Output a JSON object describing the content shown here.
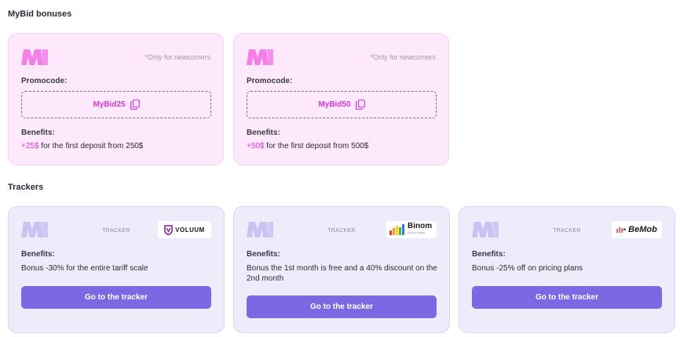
{
  "sections": {
    "mybid_title": "MyBid bonuses",
    "trackers_title": "Trackers"
  },
  "bonuses": [
    {
      "logo_icon": "mybid-m-logo",
      "note": "*Only for newcomers",
      "promo_label": "Promocode:",
      "promo_code": "MyBid25",
      "copy_icon": "copy-icon",
      "benefits_label": "Benefits:",
      "benefit_amount": "+25$",
      "benefit_text": " for the first deposit from 250$"
    },
    {
      "logo_icon": "mybid-m-logo",
      "note": "*Only for newcomers",
      "promo_label": "Promocode:",
      "promo_code": "MyBid50",
      "copy_icon": "copy-icon",
      "benefits_label": "Benefits:",
      "benefit_amount": "+50$",
      "benefit_text": " for the first deposit from 500$"
    }
  ],
  "trackers": [
    {
      "tag": "TRACKER",
      "partner": "VOLUUM",
      "partner_icon": "voluum-shield-icon",
      "benefits_label": "Benefits:",
      "benefit_text": "Bonus -30% for the entire tariff scale",
      "button_label": "Go to the tracker"
    },
    {
      "tag": "TRACKER",
      "partner": "Binom",
      "partner_subtitle": "your pro tracking",
      "partner_icon": "binom-bars-icon",
      "benefits_label": "Benefits:",
      "benefit_text": "Bonus the 1st month is free and a 40% discount on the 2nd month",
      "button_label": "Go to the tracker"
    },
    {
      "tag": "TRACKER",
      "partner": "BeMob",
      "partner_icon": "bemob-wave-icon",
      "benefits_label": "Benefits:",
      "benefit_text": "Bonus -25% off on pricing plans",
      "button_label": "Go to the tracker"
    }
  ],
  "colors": {
    "accent_pink": "#d03ad6",
    "button_purple": "#7d68e3",
    "bonus_card_bg": "#fde9fb",
    "tracker_card_bg": "#eeecfb"
  }
}
